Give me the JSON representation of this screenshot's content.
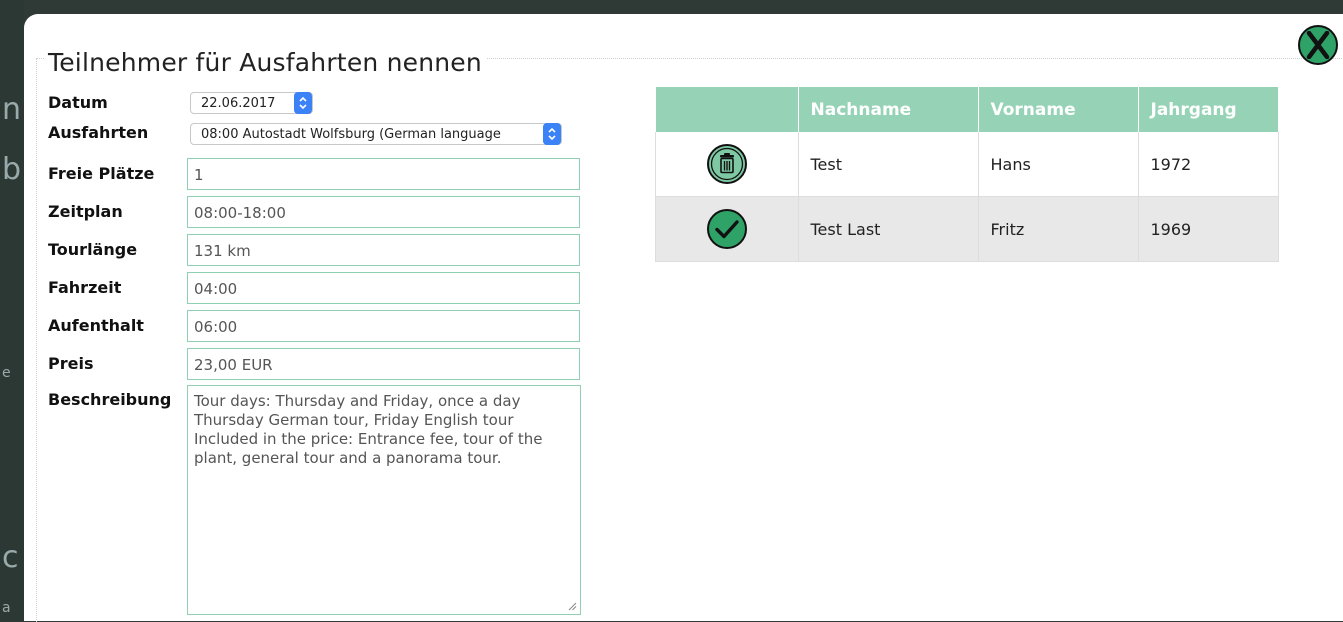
{
  "dialog": {
    "title": "Teilnehmer für Ausfahrten nennen"
  },
  "background_letters": [
    "n",
    "b",
    "e",
    "c",
    "a"
  ],
  "form": {
    "datum_label": "Datum",
    "datum_value": "22.06.2017",
    "ausfahrten_label": "Ausfahrten",
    "ausfahrten_value": "08:00 Autostadt Wolfsburg (German language",
    "freie_plaetze_label": "Freie Plätze",
    "freie_plaetze_value": "1",
    "zeitplan_label": "Zeitplan",
    "zeitplan_value": "08:00-18:00",
    "tourlaenge_label": "Tourlänge",
    "tourlaenge_value": "131 km",
    "fahrzeit_label": "Fahrzeit",
    "fahrzeit_value": "04:00",
    "aufenthalt_label": "Aufenthalt",
    "aufenthalt_value": "06:00",
    "preis_label": "Preis",
    "preis_value": "23,00 EUR",
    "beschreibung_label": "Beschreibung",
    "beschreibung_value": "Tour days: Thursday and Friday, once a day\nThursday German tour, Friday English tour\nIncluded in the price: Entrance fee, tour of the plant, general tour and a panorama tour."
  },
  "table": {
    "headers": [
      "",
      "Nachname",
      "Vorname",
      "Jahrgang"
    ],
    "rows": [
      {
        "icon": "trash-icon",
        "nachname": "Test",
        "vorname": "Hans",
        "jahrgang": "1972"
      },
      {
        "icon": "checkmark-icon",
        "nachname": "Test Last",
        "vorname": "Fritz",
        "jahrgang": "1969"
      }
    ]
  },
  "colors": {
    "accent": "#96d3b6",
    "icon_green": "#2fa267",
    "input_border": "#8fd0b3",
    "select_arrow": "#3b82f6"
  }
}
